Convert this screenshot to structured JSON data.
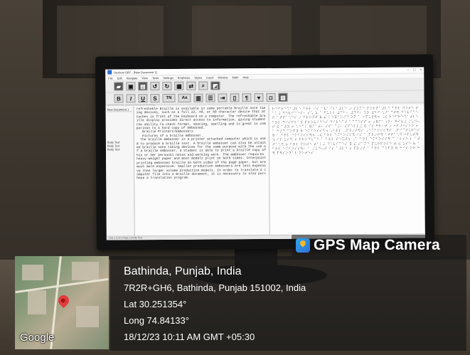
{
  "app": {
    "title": "Duxbury DBT - [New Document 1]",
    "window_controls": [
      "–",
      "□",
      "×"
    ],
    "menu": [
      "File",
      "Edit",
      "Navigate",
      "View",
      "Tools",
      "Settings",
      "Emphasis",
      "Styles",
      "Insert",
      "Window",
      "Math",
      "Help"
    ],
    "toolbar_row1": [
      "open-icon",
      "save-icon",
      "print-icon",
      "undo-icon",
      "redo-icon",
      "grid-icon",
      "translate-icon",
      "find-icon",
      "image-icon"
    ],
    "toolbar_row2": [
      "B",
      "I",
      "U",
      "S",
      "TN",
      "Aa"
    ],
    "tabs": [
      "ACTIVE",
      "BLOCK Body Text"
    ],
    "tree_title": "New Document 1",
    "tree_items": [
      "Body Text",
      "Body Text",
      "Body Text"
    ],
    "print_text": "refreshable Braille is available in some portable Braille note taking devices, such as a full 32, 40, or 80 character device that attaches in front of the keyboard on a computer. The refreshable braille display provides direct access to information, giving student the ability to check format, spacing, spelling and is great in comparison to a hard copy of embossed.\n   Braille Printers/Embossers\n   Pictures of a braille embosser.\n  The braille embosser is a printer attached computer which is used to produce a braille text. A braille embosser can also be attached braille note taking devices for the same purpose with the use of a braille embosser, a student is able to print a braille copy of his or her personal notes and working work. The embosser requires heavy-weight paper and most models print on both sides. Interpoint printing embosses braille on both sides of the page paper, but are much more expensive. Smaller production embossers are less expensive than larger volume production models. In order to translate a computer file into a Braille document, it is necessary to also purchase a translation program.",
    "braille_text": "⠗⠑⠋⠗⠑⠩⠁⠼⠇⠑ ⠃⠗⠇ ⠊⠎ ⠁⠧⠁⠊⠇⠁⠼⠇⠑ ⠔ ⠎⠕⠍⠑ ⠏⠕⠗⠞⠁⠼⠇⠑ ⠃⠗⠇ ⠝⠕⠞⠑ ⠞⠁⠅⠬ ⠙⠑⠧⠊⠉⠑⠎⠂ ⠎⠡ ⠵ ⠁ ⠋⠥⠇⠇ ⠼⠉⠃⠂ ⠼⠙⠚⠂ ⠕⠗ ⠼⠓⠚ ⠡⠜⠁⠉⠞⠻ ⠙⠑⠧⠊⠉⠑ ⠞ ⠁⠞⠞⠁⠡⠑⠎ ⠔ ⠋⠗⠕⠝⠞ ⠷ ⠮ ⠅⠑⠽⠃⠕⠜⠙ ⠕⠝ ⠁ ⠒⠏⠥⠞⠻⠲ ⠠⠮ ⠗⠑⠋⠗⠑⠩⠁⠼⠇⠑ ⠃⠗⠇ ⠙⠊⠎⠏⠇⠁⠽ ⠏⠗⠕⠧⠊⠙⠑⠎ ⠙⠊⠗⠑⠉⠞ ⠁⠉⠉⠑⠎⠎ ⠖ ⠔⠿⠍⠁⠰⠝⠂ ⠛⠊⠧⠬ ⠌⠥⠙⠢⠞ ⠮ ⠁⠼⠽ ⠖ ⠡⠑⠉⠅ ⠿⠍⠁⠞⠂ ⠎⠏⠁⠉⠬⠂ ⠎⠏⠑⠇⠇⠬ ⠯ ⠊⠎ ⠛⠗⠂⠞ ⠔ ⠒⠏⠜⠊⠎⠕⠝ ⠖ ⠁ ⠓⠜⠙ ⠉⠕⠏⠽ ⠷ ⠑⠍⠃⠕⠎⠎⠫⠲ ⠠⠃⠗⠇ ⠠⠏⠗⠔⠞⠻⠎ ⠠⠑⠍⠃⠕⠎⠎⠻⠎ ⠠⠏⠊⠉⠞⠥⠗⠑⠎ ⠷ ⠁ ⠃⠗⠇ ⠑⠍⠃⠕⠎⠎⠻⠲ ⠠⠮ ⠃⠗⠇ ⠑⠍⠃⠕⠎⠎⠻ ⠊⠎ ⠁ ⠏⠗⠔⠞⠻ ⠁⠞⠞⠁⠡⠫ ⠒⠏⠥⠞⠻ ⠱ ⠊⠎ ⠥⠎⠫ ⠖ ⠏⠗⠕⠙⠥⠉⠑ ⠁ ⠃⠗⠇ ⠞⠑⠭⠞⠲ ⠠⠁ ⠃⠗⠇ ⠑⠍⠃⠕⠎⠎⠻ ⠉ ⠁⠇⠎⠕ ⠆ ⠁⠞⠞⠁⠡⠫ ⠖ ⠃⠗⠇ ⠝⠕⠞⠑ ⠞⠁⠅⠬ ⠙⠑⠧⠊⠉⠑⠎ ⠿ ⠮ ⠎⠁⠍⠑ ⠏⠥⠗⠏⠕⠎⠑ ⠾ ⠮ ⠥⠎⠑ ⠷ ⠁ ⠃⠗⠇ ⠑⠍⠃⠕⠎⠎⠻⠂ ⠁ ⠌⠥⠙⠢⠞ ⠊⠎ ⠁⠼⠇⠑ ⠖ ⠏⠗⠔⠞ ⠁ ⠃⠗⠇ ⠉⠕⠏⠽ ⠷ ⠓⠊⠎ ⠕⠗ ⠓⠻ ⠏⠻⠎⠕⠝⠁⠇ ⠝⠕⠞⠑⠎",
    "status": "Line 1  Col 1  Page 1  Body Text"
  },
  "gps": {
    "brand": "GPS Map Camera",
    "city": "Bathinda, Punjab, India",
    "address": "7R2R+GH6, Bathinda, Punjab 151002, India",
    "lat": "Lat 30.251354°",
    "long": "Long 74.84133°",
    "datetime": "18/12/23 10:11 AM GMT +05:30",
    "map_provider": "Google"
  }
}
